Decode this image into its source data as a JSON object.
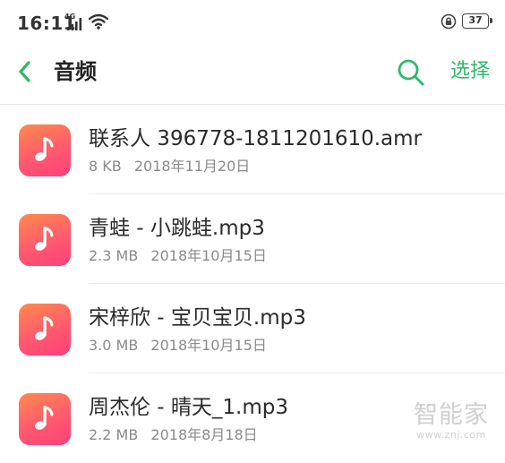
{
  "status_bar": {
    "time": "16:11",
    "network": "4G",
    "battery": "37"
  },
  "header": {
    "title": "音频",
    "select_label": "选择"
  },
  "files": [
    {
      "name": "联系人 396778-1811201610.amr",
      "size": "8 KB",
      "date": "2018年11月20日"
    },
    {
      "name": "青蛙 - 小跳蛙.mp3",
      "size": "2.3 MB",
      "date": "2018年10月15日"
    },
    {
      "name": "宋梓欣 - 宝贝宝贝.mp3",
      "size": "3.0 MB",
      "date": "2018年10月15日"
    },
    {
      "name": "周杰伦 - 晴天_1.mp3",
      "size": "2.2 MB",
      "date": "2018年8月18日"
    }
  ],
  "watermark": {
    "brand": "智能家",
    "url": "www.znj.com"
  },
  "colors": {
    "accent": "#2eb86a",
    "icon_gradient_start": "#ff8a4c",
    "icon_gradient_end": "#ff3f7a"
  },
  "icons": {
    "back": "back-arrow-icon",
    "search": "search-icon",
    "file": "music-note-icon"
  }
}
